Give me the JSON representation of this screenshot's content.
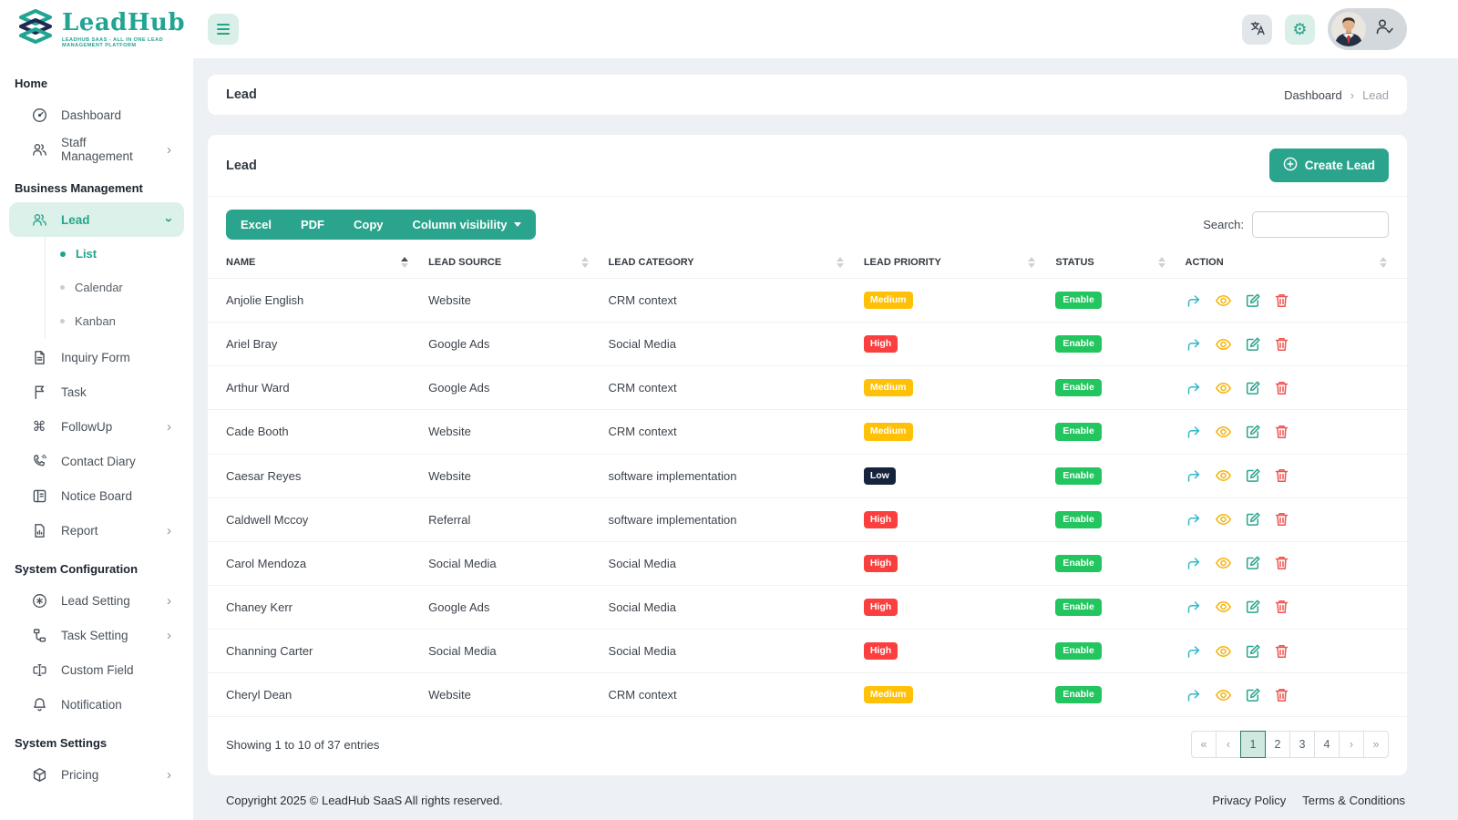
{
  "brand": {
    "name": "LeadHub",
    "tagline": "LEADHUB SAAS - ALL IN ONE LEAD MANAGEMENT PLATFORM"
  },
  "sidebar": {
    "sections": [
      {
        "label": "Home",
        "items": [
          {
            "label": "Dashboard",
            "icon": "gauge-icon"
          },
          {
            "label": "Staff Management",
            "icon": "people-icon",
            "chevron": "›"
          }
        ]
      },
      {
        "label": "Business Management",
        "items": [
          {
            "label": "Lead",
            "icon": "people-icon",
            "chevron": "›",
            "active": true,
            "children": [
              "List",
              "Calendar",
              "Kanban"
            ],
            "active_child": "List"
          },
          {
            "label": "Inquiry Form",
            "icon": "file-icon"
          },
          {
            "label": "Task",
            "icon": "flag-icon"
          },
          {
            "label": "FollowUp",
            "icon": "command-icon",
            "chevron": "›"
          },
          {
            "label": "Contact Diary",
            "icon": "phone-icon"
          },
          {
            "label": "Notice Board",
            "icon": "board-icon"
          },
          {
            "label": "Report",
            "icon": "report-icon",
            "chevron": "›"
          }
        ]
      },
      {
        "label": "System Configuration",
        "items": [
          {
            "label": "Lead Setting",
            "icon": "circle-star-icon",
            "chevron": "›"
          },
          {
            "label": "Task Setting",
            "icon": "hierarchy-icon",
            "chevron": "›"
          },
          {
            "label": "Custom Field",
            "icon": "input-field-icon"
          },
          {
            "label": "Notification",
            "icon": "bell-icon"
          }
        ]
      },
      {
        "label": "System Settings",
        "items": [
          {
            "label": "Pricing",
            "icon": "package-icon",
            "chevron": "›"
          }
        ]
      }
    ]
  },
  "breadcrumb": {
    "title": "Lead",
    "home": "Dashboard",
    "separator": "›",
    "current": "Lead"
  },
  "content": {
    "title": "Lead",
    "create_button": "Create Lead"
  },
  "toolbar": {
    "export_buttons": [
      "Excel",
      "PDF",
      "Copy"
    ],
    "column_visibility": "Column visibility",
    "search_label": "Search:",
    "search_value": ""
  },
  "table": {
    "columns": [
      "NAME",
      "LEAD SOURCE",
      "LEAD CATEGORY",
      "LEAD PRIORITY",
      "STATUS",
      "ACTION"
    ],
    "sorted_column": "NAME",
    "rows": [
      {
        "name": "Anjolie English",
        "source": "Website",
        "category": "CRM context",
        "priority": "Medium",
        "status": "Enable"
      },
      {
        "name": "Ariel Bray",
        "source": "Google Ads",
        "category": "Social Media",
        "priority": "High",
        "status": "Enable"
      },
      {
        "name": "Arthur Ward",
        "source": "Google Ads",
        "category": "CRM context",
        "priority": "Medium",
        "status": "Enable"
      },
      {
        "name": "Cade Booth",
        "source": "Website",
        "category": "CRM context",
        "priority": "Medium",
        "status": "Enable"
      },
      {
        "name": "Caesar Reyes",
        "source": "Website",
        "category": "software implementation",
        "priority": "Low",
        "status": "Enable"
      },
      {
        "name": "Caldwell Mccoy",
        "source": "Referral",
        "category": "software implementation",
        "priority": "High",
        "status": "Enable"
      },
      {
        "name": "Carol Mendoza",
        "source": "Social Media",
        "category": "Social Media",
        "priority": "High",
        "status": "Enable"
      },
      {
        "name": "Chaney Kerr",
        "source": "Google Ads",
        "category": "Social Media",
        "priority": "High",
        "status": "Enable"
      },
      {
        "name": "Channing Carter",
        "source": "Social Media",
        "category": "Social Media",
        "priority": "High",
        "status": "Enable"
      },
      {
        "name": "Cheryl Dean",
        "source": "Website",
        "category": "CRM context",
        "priority": "Medium",
        "status": "Enable"
      }
    ],
    "summary": "Showing 1 to 10 of 37 entries",
    "pagination": {
      "first": "«",
      "prev": "‹",
      "pages": [
        "1",
        "2",
        "3",
        "4"
      ],
      "next": "›",
      "last": "»",
      "active": "1"
    }
  },
  "footer": {
    "copyright": "Copyright 2025 © LeadHub SaaS All rights reserved.",
    "links": [
      "Privacy Policy",
      "Terms & Conditions"
    ]
  },
  "colors": {
    "accent": "#2aa48c",
    "accent_light": "#d9efe8",
    "priority_high": "#fa3f3e",
    "priority_medium": "#ffc107",
    "priority_low": "#15233c",
    "status_enable": "#22c55e",
    "action_view": "#f7b200",
    "action_convert": "#35b8c9",
    "action_edit": "#2aa48c",
    "action_delete": "#ef5350"
  }
}
